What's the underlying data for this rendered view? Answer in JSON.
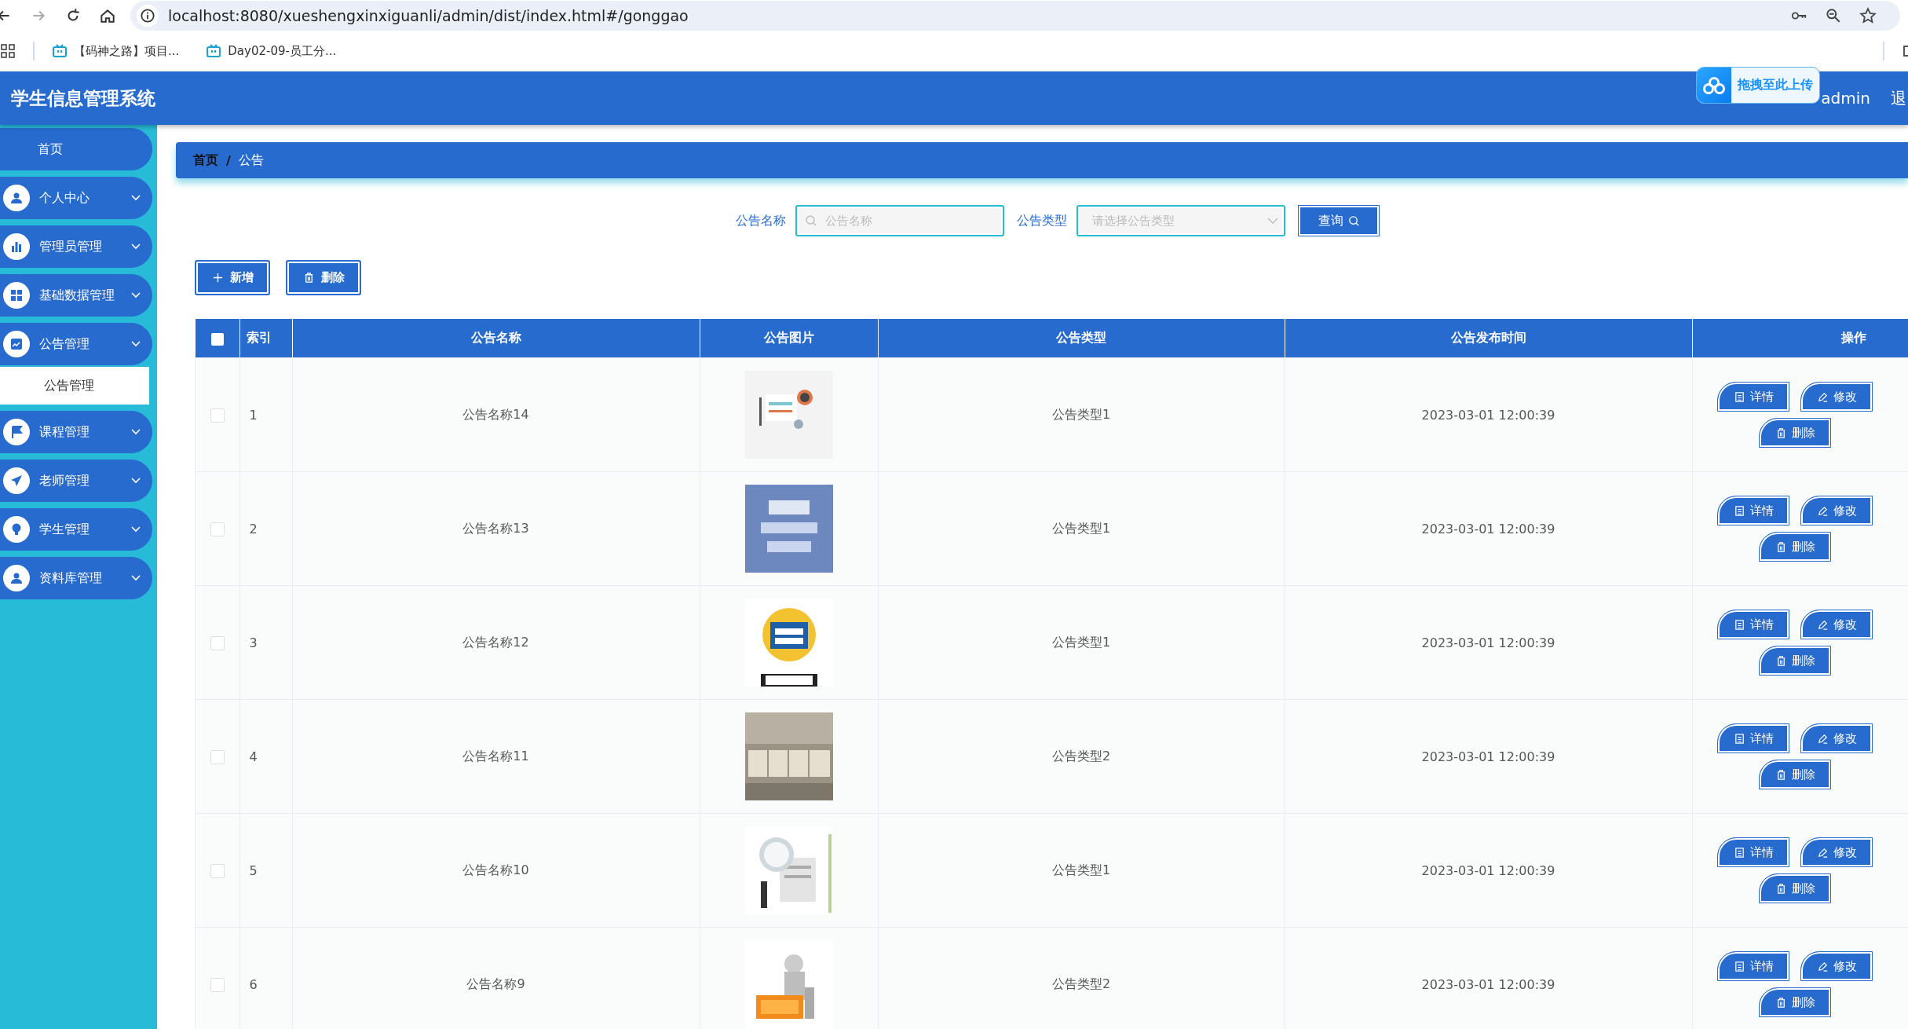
{
  "browser": {
    "url": "localhost:8080/xueshengxinxiguanli/admin/dist/index.html#/gonggao",
    "bookmarks": [
      "【码神之路】项目...",
      "Day02-09-员工分..."
    ]
  },
  "header": {
    "title": "学生信息管理系统",
    "user": "admin",
    "logout": "退"
  },
  "upload_widget": {
    "label": "拖拽至此上传"
  },
  "sidebar": {
    "items": [
      {
        "label": "首页",
        "kind": "home"
      },
      {
        "label": "个人中心",
        "kind": "group"
      },
      {
        "label": "管理员管理",
        "kind": "group"
      },
      {
        "label": "基础数据管理",
        "kind": "group"
      },
      {
        "label": "公告管理",
        "kind": "group",
        "children": [
          {
            "label": "公告管理",
            "selected": true
          }
        ]
      },
      {
        "label": "课程管理",
        "kind": "group"
      },
      {
        "label": "老师管理",
        "kind": "group"
      },
      {
        "label": "学生管理",
        "kind": "group"
      },
      {
        "label": "资料库管理",
        "kind": "group"
      }
    ]
  },
  "breadcrumb": {
    "items": [
      "首页",
      "公告"
    ],
    "separator": "/"
  },
  "search": {
    "fields": [
      {
        "label": "公告名称",
        "kind": "text",
        "placeholder": "公告名称"
      },
      {
        "label": "公告类型",
        "kind": "select",
        "placeholder": "请选择公告类型"
      }
    ],
    "button": "查询"
  },
  "actions": [
    "新增",
    "删除"
  ],
  "table": {
    "all_checked": false,
    "columns": [
      "索引",
      "公告名称",
      "公告图片",
      "公告类型",
      "公告发布时间",
      "操作"
    ],
    "rows": [
      {
        "checked": false,
        "index": "1",
        "name": "公告名称14",
        "type": "公告类型1",
        "time": "2023-03-01 12:00:39",
        "buttons": [
          "详情",
          "修改",
          "删除"
        ]
      },
      {
        "checked": false,
        "index": "2",
        "name": "公告名称13",
        "type": "公告类型1",
        "time": "2023-03-01 12:00:39",
        "buttons": [
          "详情",
          "修改",
          "删除"
        ]
      },
      {
        "checked": false,
        "index": "3",
        "name": "公告名称12",
        "type": "公告类型1",
        "time": "2023-03-01 12:00:39",
        "buttons": [
          "详情",
          "修改",
          "删除"
        ]
      },
      {
        "checked": false,
        "index": "4",
        "name": "公告名称11",
        "type": "公告类型2",
        "time": "2023-03-01 12:00:39",
        "buttons": [
          "详情",
          "修改",
          "删除"
        ]
      },
      {
        "checked": false,
        "index": "5",
        "name": "公告名称10",
        "type": "公告类型1",
        "time": "2023-03-01 12:00:39",
        "buttons": [
          "详情",
          "修改",
          "删除"
        ]
      },
      {
        "checked": false,
        "index": "6",
        "name": "公告名称9",
        "type": "公告类型2",
        "time": "2023-03-01 12:00:39",
        "buttons": [
          "详情",
          "修改",
          "删除"
        ]
      }
    ]
  }
}
